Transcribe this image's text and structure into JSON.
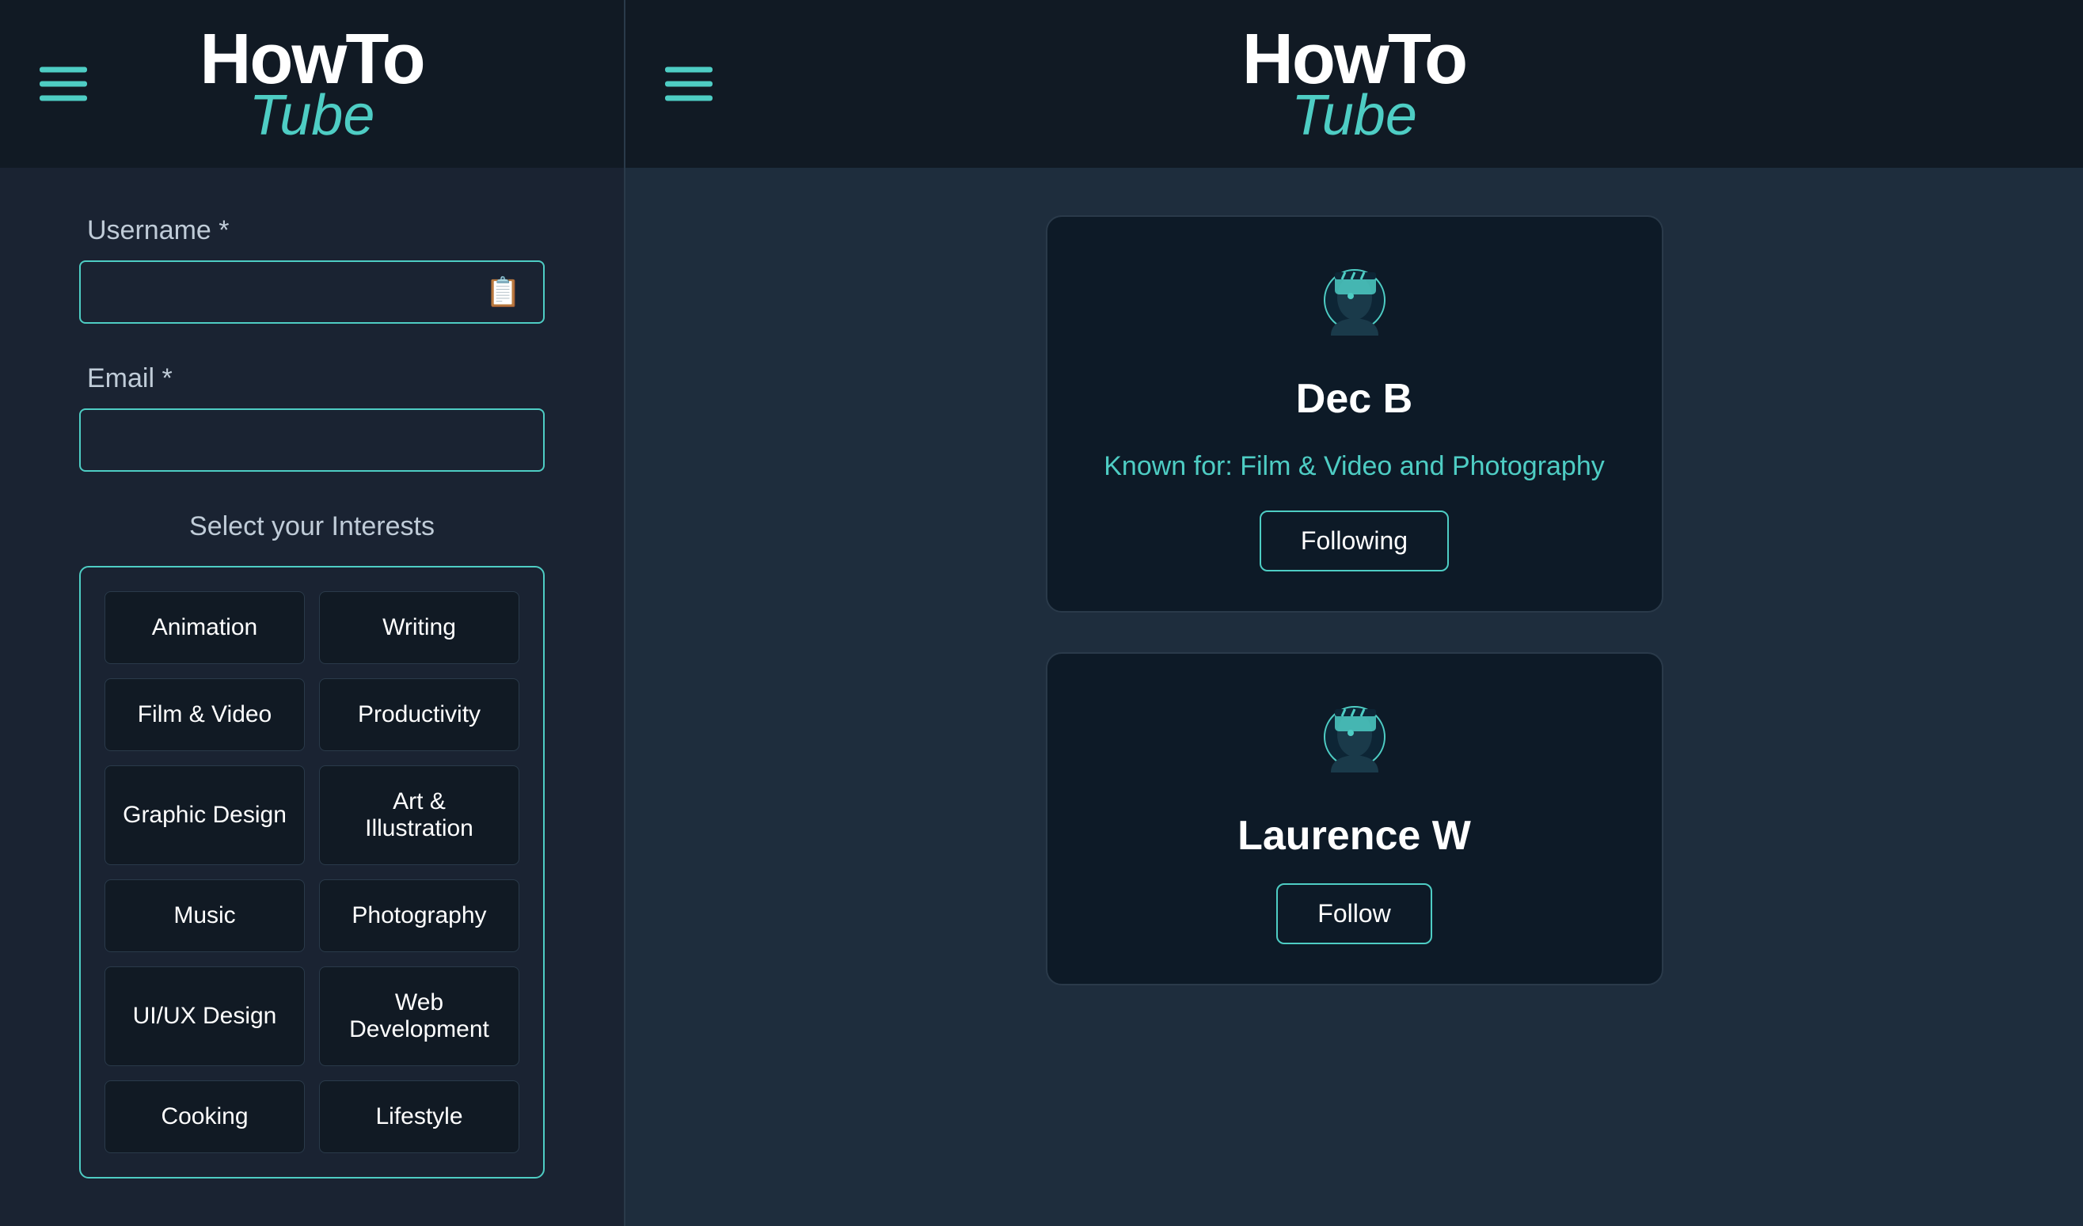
{
  "left": {
    "logo": {
      "how": "How",
      "to": "To",
      "tube": "Tube"
    },
    "hamburger_label": "Menu",
    "form": {
      "username_label": "Username *",
      "username_placeholder": "",
      "email_label": "Email *",
      "email_placeholder": "",
      "interests_label": "Select your Interests",
      "interests": [
        {
          "id": "animation",
          "label": "Animation"
        },
        {
          "id": "writing",
          "label": "Writing"
        },
        {
          "id": "film-video",
          "label": "Film & Video"
        },
        {
          "id": "productivity",
          "label": "Productivity"
        },
        {
          "id": "graphic-design",
          "label": "Graphic Design"
        },
        {
          "id": "art-illustration",
          "label": "Art & Illustration"
        },
        {
          "id": "music",
          "label": "Music"
        },
        {
          "id": "photography",
          "label": "Photography"
        },
        {
          "id": "ui-ux-design",
          "label": "UI/UX Design"
        },
        {
          "id": "web-development",
          "label": "Web Development"
        },
        {
          "id": "cooking",
          "label": "Cooking"
        },
        {
          "id": "lifestyle",
          "label": "Lifestyle"
        }
      ]
    }
  },
  "right": {
    "logo": {
      "how": "How",
      "to": "To",
      "tube": "Tube"
    },
    "hamburger_label": "Menu",
    "profiles": [
      {
        "id": "dec-b",
        "name": "Dec B",
        "known_for": "Known for: Film & Video and Photography",
        "follow_label": "Following"
      },
      {
        "id": "laurence-w",
        "name": "Laurence W",
        "known_for": "",
        "follow_label": "Follow"
      }
    ]
  }
}
